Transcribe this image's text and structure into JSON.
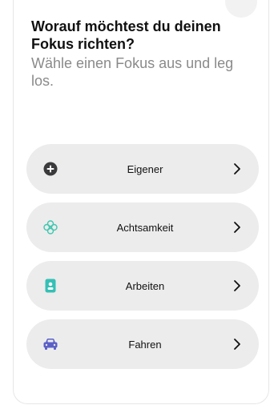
{
  "heading": {
    "title": "Worauf möchtest du deinen Fokus richten?",
    "subtitle": "Wähle einen Fokus aus und leg los."
  },
  "options": [
    {
      "label": "Eigener",
      "icon": "plus-circle-icon",
      "color": "#3a3a3c"
    },
    {
      "label": "Achtsamkeit",
      "icon": "flower-icon",
      "color": "#41c6b0"
    },
    {
      "label": "Arbeiten",
      "icon": "id-badge-icon",
      "color": "#34c0b5"
    },
    {
      "label": "Fahren",
      "icon": "car-icon",
      "color": "#5a5fc7"
    }
  ]
}
